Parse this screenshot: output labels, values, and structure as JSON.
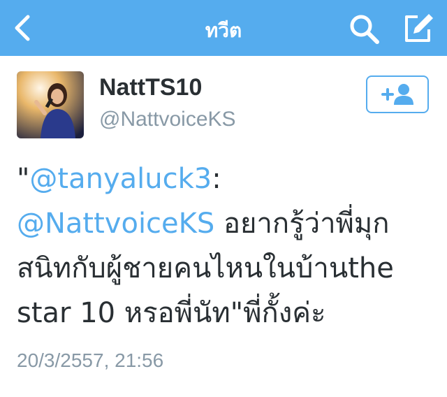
{
  "navbar": {
    "title": "ทวีต",
    "back_icon": "chevron-left-icon",
    "search_icon": "search-icon",
    "compose_icon": "compose-icon",
    "background": "#55acee"
  },
  "tweet": {
    "author": {
      "display_name": "NattTS10",
      "handle": "@NattvoiceKS"
    },
    "follow_icon": "add-user-icon",
    "text_lines": [
      {
        "quote": "\"",
        "mention": "@tanyaluck3",
        "rest": ":"
      },
      {
        "mention": "@NattvoiceKS",
        "rest": " อยากรู้ว่าพี่มุก"
      },
      {
        "rest": "สนิทกับผู้ชายคนไหนในบ้านthe"
      },
      {
        "rest": "star 10 หรอพี่นัท\"พี่กั้งค่ะ"
      }
    ],
    "timestamp": "20/3/2557, 21:56"
  },
  "colors": {
    "accent": "#55acee",
    "text": "#292f33",
    "muted": "#8899a6"
  }
}
